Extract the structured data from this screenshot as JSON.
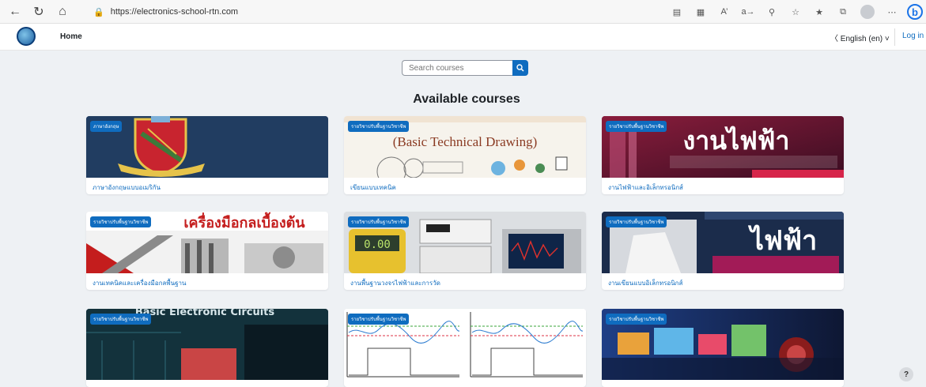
{
  "browser": {
    "url": "https://electronics-school-rtn.com"
  },
  "header": {
    "home": "Home",
    "language": "English (en)",
    "login": "Log in"
  },
  "search": {
    "placeholder": "Search courses"
  },
  "heading": "Available courses",
  "courses": [
    {
      "badge": "ภาษาอังกฤษ",
      "title": "ภาษาอังกฤษแบบอเมริกัน",
      "banner": ""
    },
    {
      "badge": "รายวิชาปรับพื้นฐานวิชาชีพ",
      "title": "เขียนแบบเทคนิค",
      "banner": "(Basic Technical Drawing)"
    },
    {
      "badge": "รายวิชาปรับพื้นฐานวิชาชีพ",
      "title": "งานไฟฟ้าและอิเล็กทรอนิกส์",
      "banner": "งานไฟฟ้า"
    },
    {
      "badge": "รายวิชาปรับพื้นฐานวิชาชีพ",
      "title": "งานเทคนิคและเครื่องมือกลพื้นฐาน",
      "banner": "เครื่องมือกลเบื้องต้น"
    },
    {
      "badge": "รายวิชาปรับพื้นฐานวิชาชีพ",
      "title": "งานพื้นฐานวงจรไฟฟ้าและการวัด",
      "banner": "0.00"
    },
    {
      "badge": "รายวิชาปรับพื้นฐานวิชาชีพ",
      "title": "งานเขียนแบบอิเล็กทรอนิกส์",
      "banner": "ไฟฟ้า"
    },
    {
      "badge": "รายวิชาปรับพื้นฐานวิชาชีพ",
      "title": "",
      "banner": "Basic Electronic Circuits"
    },
    {
      "badge": "รายวิชาปรับพื้นฐานวิชาชีพ",
      "title": "",
      "banner": ""
    },
    {
      "badge": "รายวิชาปรับพื้นฐานวิชาชีพ",
      "title": "",
      "banner": ""
    }
  ],
  "help": "?"
}
